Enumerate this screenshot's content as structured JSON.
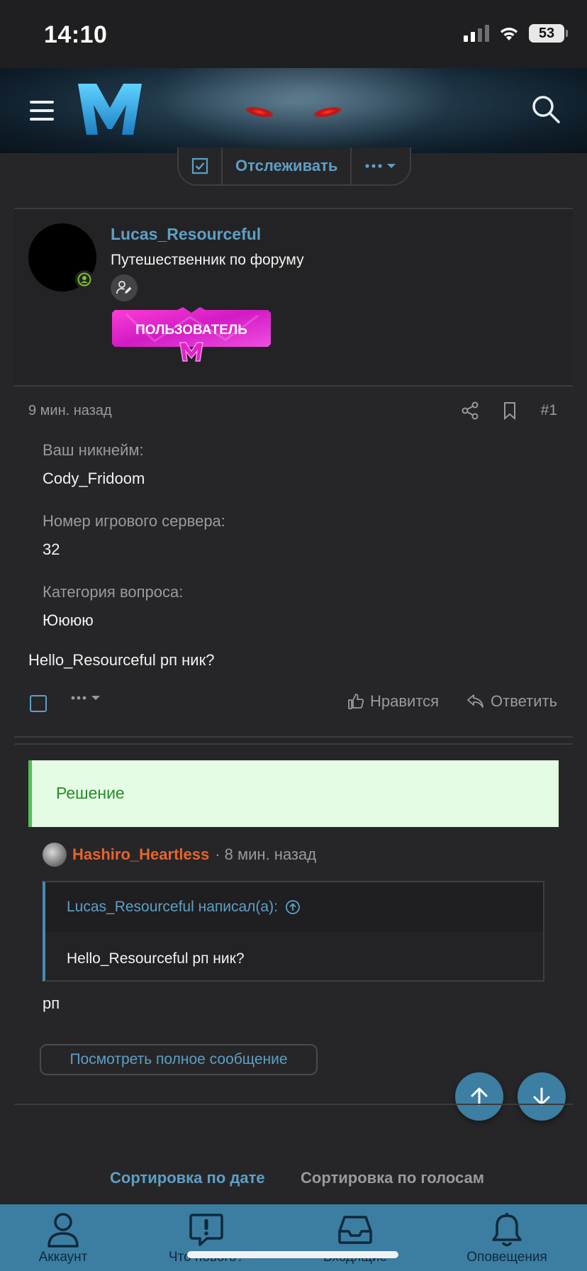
{
  "status_bar": {
    "time": "14:10",
    "battery": "53"
  },
  "header": {
    "menu_icon": "hamburger-icon",
    "logo": "M-logo",
    "search_icon": "search-icon"
  },
  "thread_actions": {
    "watch_label": "Отслеживать"
  },
  "post": {
    "author": "Lucas_Resourceful",
    "author_title": "Путешественник по форуму",
    "user_banner_text": "ПОЛЬЗОВАТЕЛЬ",
    "time": "9 мин. назад",
    "number": "#1",
    "fields": [
      {
        "label": "Ваш никнейм:",
        "value": "Cody_Fridoom"
      },
      {
        "label": "Номер игрового сервера:",
        "value": "32"
      },
      {
        "label": "Категория вопроса:",
        "value": "Юююю"
      }
    ],
    "text": "Hello_Resourceful рп ник?",
    "like_label": "Нравится",
    "reply_label": "Ответить"
  },
  "solution": {
    "label": "Решение",
    "author": "Hashiro_Heartless",
    "time": "· 8 мин. назад",
    "quote_header": "Lucas_Resourceful написал(а):",
    "quote_body": "Hello_Resourceful рп ник?",
    "text": "рп",
    "view_full_label": "Посмотреть полное сообщение"
  },
  "sort": {
    "by_date": "Сортировка по дате",
    "by_votes": "Сортировка по голосам"
  },
  "bottom_nav": [
    {
      "label": "Аккаунт",
      "icon": "user-icon"
    },
    {
      "label": "Что нового?",
      "icon": "alert-message-icon"
    },
    {
      "label": "Входящие",
      "icon": "inbox-icon"
    },
    {
      "label": "Оповещения",
      "icon": "bell-icon"
    }
  ],
  "colors": {
    "accent": "#5e9fc5",
    "nav_bg": "#3c7da2",
    "solution_bg": "#e4fce4",
    "solution_author": "#e8632e"
  }
}
